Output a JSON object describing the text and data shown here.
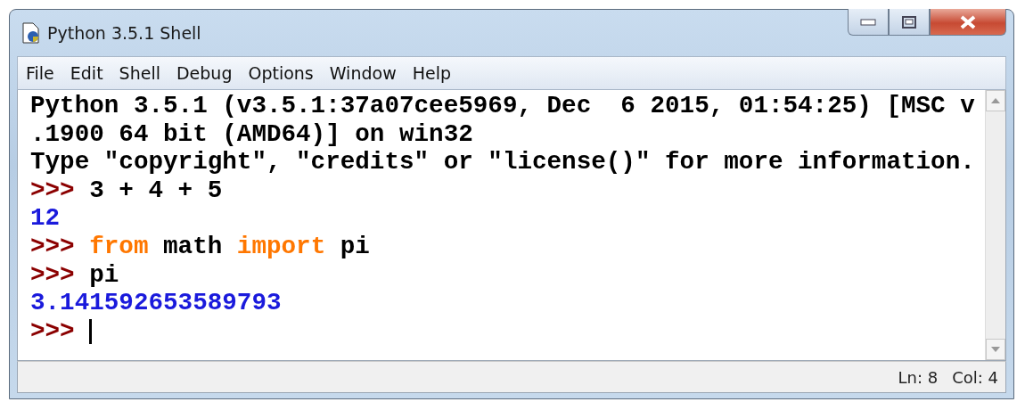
{
  "window": {
    "title": "Python 3.5.1 Shell"
  },
  "menu": [
    "File",
    "Edit",
    "Shell",
    "Debug",
    "Options",
    "Window",
    "Help"
  ],
  "shell_lines": [
    [
      {
        "kind": "text",
        "text": "Python 3.5.1 (v3.5.1:37a07cee5969, Dec  6 2015, 01:54:25) [MSC v"
      }
    ],
    [
      {
        "kind": "text",
        "text": ".1900 64 bit (AMD64)] on win32"
      }
    ],
    [
      {
        "kind": "text",
        "text": "Type \"copyright\", \"credits\" or \"license()\" for more information."
      }
    ],
    [
      {
        "kind": "prompt",
        "text": ">>> "
      },
      {
        "kind": "text",
        "text": "3 + 4 + 5"
      }
    ],
    [
      {
        "kind": "output",
        "text": "12"
      }
    ],
    [
      {
        "kind": "prompt",
        "text": ">>> "
      },
      {
        "kind": "keyword",
        "text": "from"
      },
      {
        "kind": "text",
        "text": " math "
      },
      {
        "kind": "keyword",
        "text": "import"
      },
      {
        "kind": "text",
        "text": " pi"
      }
    ],
    [
      {
        "kind": "prompt",
        "text": ">>> "
      },
      {
        "kind": "text",
        "text": "pi"
      }
    ],
    [
      {
        "kind": "output",
        "text": "3.141592653589793"
      }
    ],
    [
      {
        "kind": "prompt",
        "text": ">>> "
      },
      {
        "kind": "cursor"
      }
    ]
  ],
  "status_bar": {
    "line": "Ln: 8",
    "column": "Col: 4"
  }
}
